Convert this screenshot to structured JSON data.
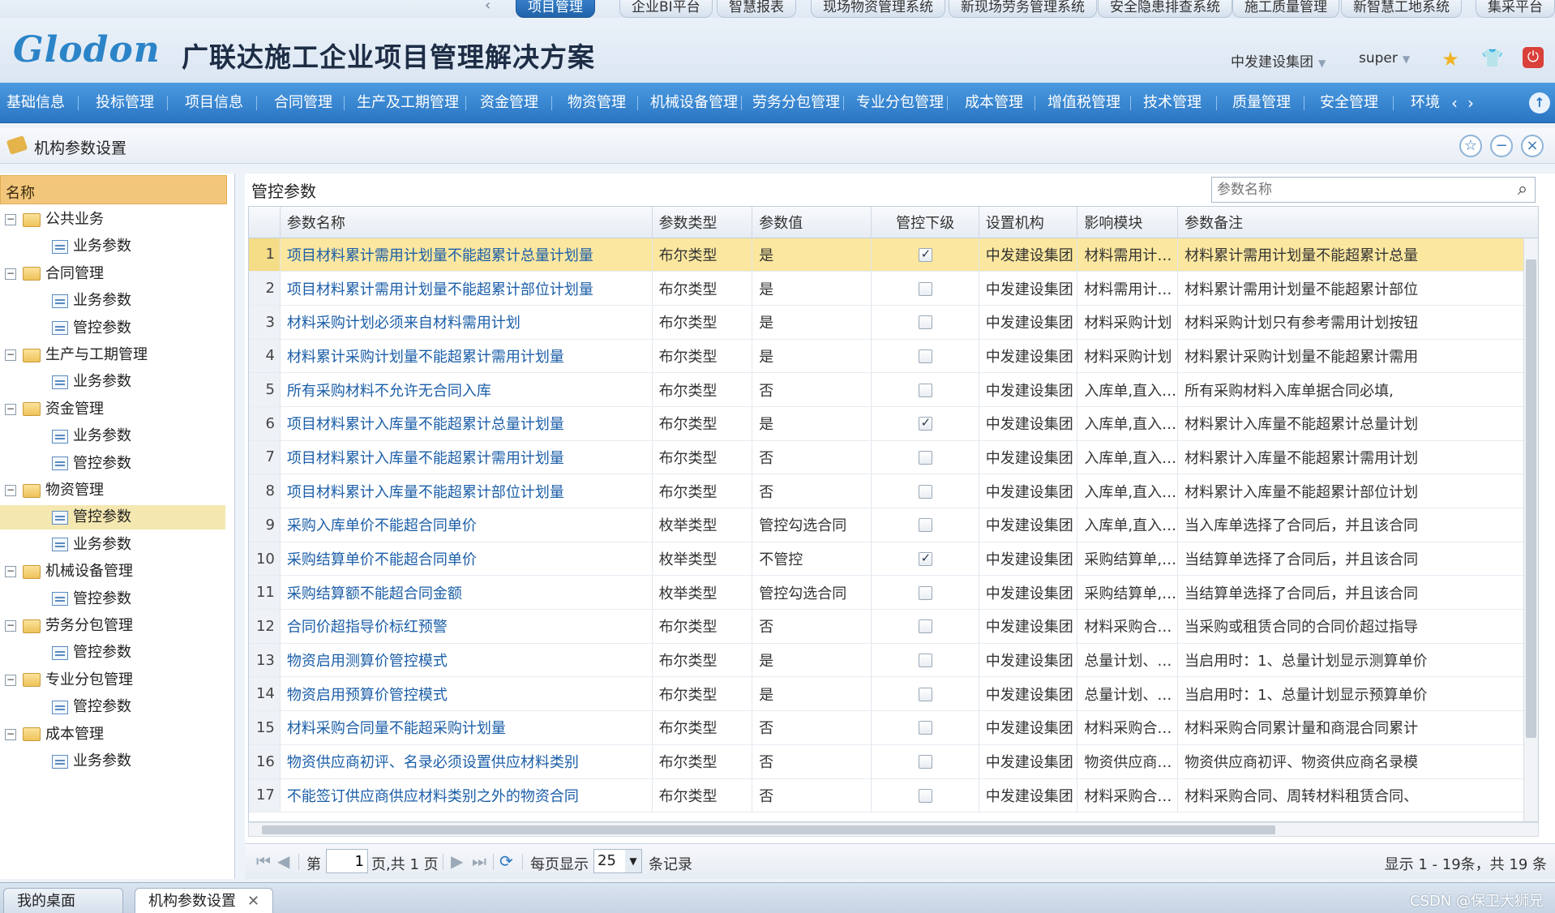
{
  "system_tabs": {
    "items": [
      "项目管理",
      "企业BI平台",
      "智慧报表",
      "现场物资管理系统",
      "新现场劳务管理系统",
      "安全隐患排查系统",
      "施工质量管理",
      "新智慧工地系统",
      "集采平台"
    ],
    "active": "项目管理",
    "accent": "#2a75c3"
  },
  "header": {
    "logo": "Glodon",
    "slogan": "广联达施工企业项目管理解决方案",
    "org": "中发建设集团",
    "user": "super",
    "icons": [
      "star-icon",
      "shirt-icon",
      "power-icon"
    ]
  },
  "nav": {
    "items": [
      "基础信息",
      "投标管理",
      "项目信息",
      "合同管理",
      "生产及工期管理",
      "资金管理",
      "物资管理",
      "机械设备管理",
      "劳务分包管理",
      "专业分包管理",
      "成本管理",
      "增值税管理",
      "技术管理",
      "质量管理",
      "安全管理",
      "环境"
    ],
    "bg": "#2a75c3"
  },
  "page": {
    "title": "机构参数设置"
  },
  "tree": {
    "header": "名称",
    "nodes": [
      {
        "label": "公共业务",
        "level": 0
      },
      {
        "label": "业务参数",
        "level": 1
      },
      {
        "label": "合同管理",
        "level": 0
      },
      {
        "label": "业务参数",
        "level": 1
      },
      {
        "label": "管控参数",
        "level": 1
      },
      {
        "label": "生产与工期管理",
        "level": 0
      },
      {
        "label": "业务参数",
        "level": 1
      },
      {
        "label": "资金管理",
        "level": 0
      },
      {
        "label": "业务参数",
        "level": 1
      },
      {
        "label": "管控参数",
        "level": 1
      },
      {
        "label": "物资管理",
        "level": 0
      },
      {
        "label": "管控参数",
        "level": 1,
        "selected": true
      },
      {
        "label": "业务参数",
        "level": 1
      },
      {
        "label": "机械设备管理",
        "level": 0
      },
      {
        "label": "管控参数",
        "level": 1
      },
      {
        "label": "劳务分包管理",
        "level": 0
      },
      {
        "label": "管控参数",
        "level": 1
      },
      {
        "label": "专业分包管理",
        "level": 0
      },
      {
        "label": "管控参数",
        "level": 1
      },
      {
        "label": "成本管理",
        "level": 0
      },
      {
        "label": "业务参数",
        "level": 1
      }
    ]
  },
  "grid": {
    "title": "管控参数",
    "search_placeholder": "参数名称",
    "columns": [
      "参数名称",
      "参数类型",
      "参数值",
      "管控下级",
      "设置机构",
      "影响模块",
      "参数备注"
    ],
    "rows": [
      [
        "1",
        "项目材料累计需用计划量不能超累计总量计划量",
        "布尔类型",
        "是",
        true,
        "中发建设集团",
        "材料需用计划,...",
        "材料累计需用计划量不能超累计总量"
      ],
      [
        "2",
        "项目材料累计需用计划量不能超累计部位计划量",
        "布尔类型",
        "是",
        false,
        "中发建设集团",
        "材料需用计划,...",
        "材料累计需用计划量不能超累计部位"
      ],
      [
        "3",
        "材料采购计划必须来自材料需用计划",
        "布尔类型",
        "是",
        false,
        "中发建设集团",
        "材料采购计划",
        "材料采购计划只有参考需用计划按钮"
      ],
      [
        "4",
        "材料累计采购计划量不能超累计需用计划量",
        "布尔类型",
        "是",
        false,
        "中发建设集团",
        "材料采购计划",
        "材料累计采购计划量不能超累计需用"
      ],
      [
        "5",
        "所有采购材料不允许无合同入库",
        "布尔类型",
        "否",
        false,
        "中发建设集团",
        "入库单,直入直...",
        "所有采购材料入库单据合同必填,"
      ],
      [
        "6",
        "项目材料累计入库量不能超累计总量计划量",
        "布尔类型",
        "是",
        true,
        "中发建设集团",
        "入库单,直入直...",
        "材料累计入库量不能超累计总量计划"
      ],
      [
        "7",
        "项目材料累计入库量不能超累计需用计划量",
        "布尔类型",
        "否",
        false,
        "中发建设集团",
        "入库单,直入直...",
        "材料累计入库量不能超累计需用计划"
      ],
      [
        "8",
        "项目材料累计入库量不能超累计部位计划量",
        "布尔类型",
        "否",
        false,
        "中发建设集团",
        "入库单,直入直...",
        "材料累计入库量不能超累计部位计划"
      ],
      [
        "9",
        "采购入库单价不能超合同单价",
        "枚举类型",
        "管控勾选合同",
        false,
        "中发建设集团",
        "入库单,直入直...",
        "当入库单选择了合同后，并且该合同"
      ],
      [
        "10",
        "采购结算单价不能超合同单价",
        "枚举类型",
        "不管控",
        true,
        "中发建设集团",
        "采购结算单,材...",
        "当结算单选择了合同后，并且该合同"
      ],
      [
        "11",
        "采购结算额不能超合同金额",
        "枚举类型",
        "管控勾选合同",
        false,
        "中发建设集团",
        "采购结算单,材...",
        "当结算单选择了合同后，并且该合同"
      ],
      [
        "12",
        "合同价超指导价标红预警",
        "布尔类型",
        "否",
        false,
        "中发建设集团",
        "材料采购合同,...",
        "当采购或租赁合同的合同价超过指导"
      ],
      [
        "13",
        "物资启用测算价管控模式",
        "布尔类型",
        "是",
        false,
        "中发建设集团",
        "总量计划、材...",
        "当启用时：1、总量计划显示测算单价"
      ],
      [
        "14",
        "物资启用预算价管控模式",
        "布尔类型",
        "是",
        false,
        "中发建设集团",
        "总量计划、材...",
        "当启用时：1、总量计划显示预算单价"
      ],
      [
        "15",
        "材料采购合同量不能超采购计划量",
        "布尔类型",
        "否",
        false,
        "中发建设集团",
        "材料采购合同...",
        "材料采购合同累计量和商混合同累计"
      ],
      [
        "16",
        "物资供应商初评、名录必须设置供应材料类别",
        "布尔类型",
        "否",
        false,
        "中发建设集团",
        "物资供应商初...",
        "物资供应商初评、物资供应商名录模"
      ],
      [
        "17",
        "不能签订供应商供应材料类别之外的物资合同",
        "布尔类型",
        "否",
        false,
        "中发建设集团",
        "材料采购合同...",
        "材料采购合同、周转材料租赁合同、"
      ]
    ]
  },
  "pager": {
    "page_prefix": "第",
    "page_value": "1",
    "page_suffix": "页,共 1 页",
    "per_page_label": "每页显示",
    "per_page_value": "25",
    "records_label": "条记录",
    "summary": "显示 1 - 19条，共 19 条"
  },
  "taskbar": {
    "tabs": [
      "我的桌面",
      "机构参数设置"
    ],
    "active": "机构参数设置",
    "watermark": "CSDN @保卫大狮兄"
  }
}
